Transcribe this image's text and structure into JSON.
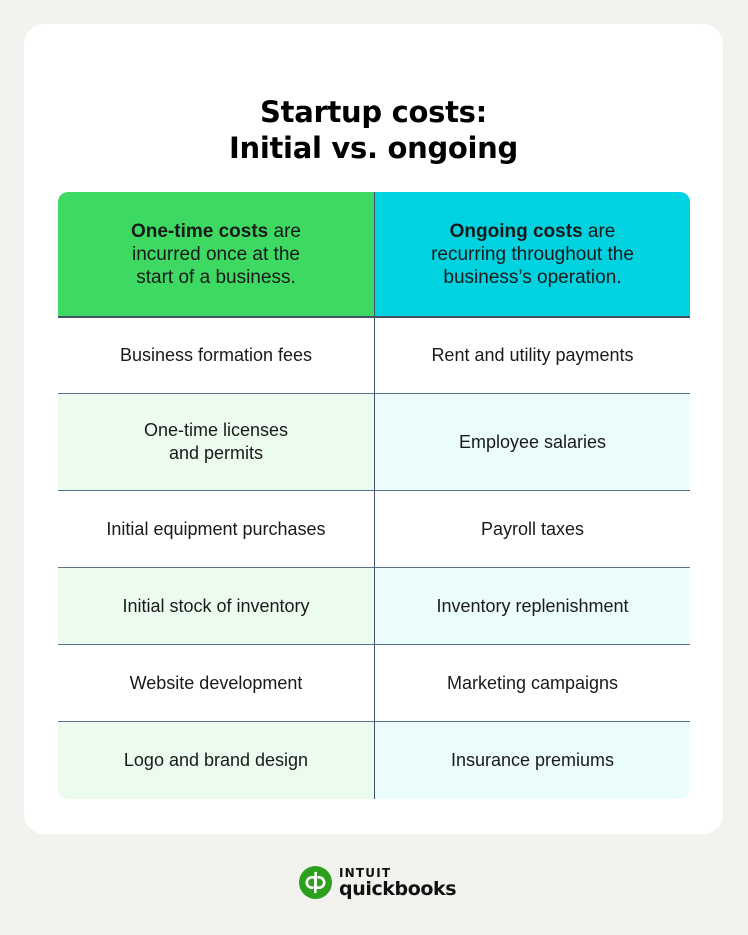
{
  "title": {
    "line1": "Startup costs:",
    "line2": "Initial vs. ongoing"
  },
  "header": {
    "left": {
      "bold": "One-time costs",
      "rest_line1": " are",
      "line2": "incurred once at the",
      "line3": "start of a business."
    },
    "right": {
      "bold": "Ongoing costs",
      "rest_line1": " are",
      "line2": "recurring throughout the",
      "line3": "business’s operation."
    }
  },
  "colors": {
    "one_time_header": "#3dd962",
    "ongoing_header": "#00d2e0",
    "one_time_tint": "#ebfcee",
    "ongoing_tint": "#ebfcfd",
    "divider": "#3e5466",
    "background": "#f2f2ee",
    "brand_green": "#2ca01c"
  },
  "rows": [
    {
      "left": "Business formation fees",
      "right": "Rent and utility payments"
    },
    {
      "left_line1": "One-time licenses",
      "left_line2": "and permits",
      "right": "Employee salaries"
    },
    {
      "left": "Initial equipment purchases",
      "right": "Payroll taxes"
    },
    {
      "left": "Initial stock of inventory",
      "right": "Inventory replenishment"
    },
    {
      "left": "Website development",
      "right": "Marketing campaigns"
    },
    {
      "left": "Logo and brand design",
      "right": "Insurance premiums"
    }
  ],
  "logo": {
    "icon": "quickbooks-logo-icon",
    "brand": "INTUIT",
    "product": "quickbooks",
    "glyph": "qb"
  }
}
